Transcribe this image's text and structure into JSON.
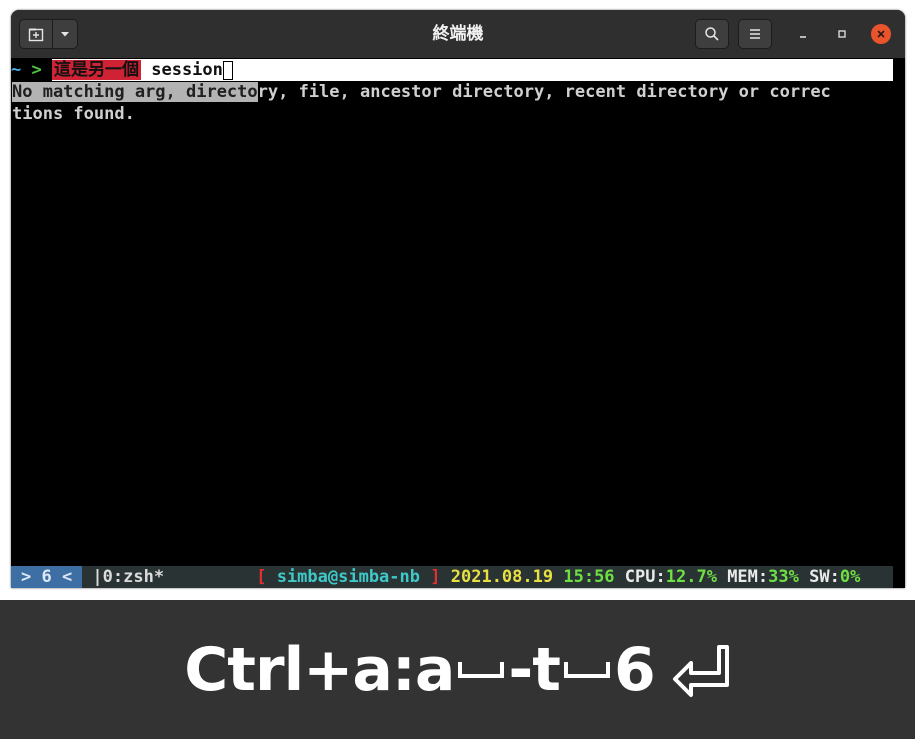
{
  "window": {
    "title": "終端機",
    "icons": {
      "new_tab": "new-tab-icon",
      "dropdown": "chevron-down-icon",
      "search": "search-icon",
      "menu": "hamburger-menu-icon",
      "minimize": "minimize-icon",
      "maximize": "maximize-icon",
      "close": "close-icon"
    }
  },
  "terminal": {
    "prompt_tilde": "~",
    "prompt_arrow": ">",
    "prompt_label": "這是另一個",
    "input_text": " session",
    "output_highlighted": "No matching arg, directo",
    "output_rest": "ry, file, ancestor directory, recent directory or correc",
    "output_line2": "tions found."
  },
  "statusbar": {
    "window_indicator": "> 6 <",
    "tab": " |0:zsh*",
    "bracket_open": "[",
    "host": "simba@simba-nb",
    "bracket_close": "]",
    "date": "2021.08.19",
    "time": "15:56",
    "cpu_label": "CPU:",
    "cpu_value": "12.7%",
    "mem_label": "MEM:",
    "mem_value": "33%",
    "sw_label": "SW:",
    "sw_value": "0%"
  },
  "caption": {
    "part1": "Ctrl+a:a",
    "part2": "-t",
    "part3": "6",
    "enter_icon": "enter-return-icon"
  },
  "colors": {
    "titlebar": "#2f2f2f",
    "close_button": "#e9542c",
    "prompt_label_bg": "#cf2234",
    "status_window_bg": "#3d6fa5",
    "caption_bg": "#333333"
  }
}
